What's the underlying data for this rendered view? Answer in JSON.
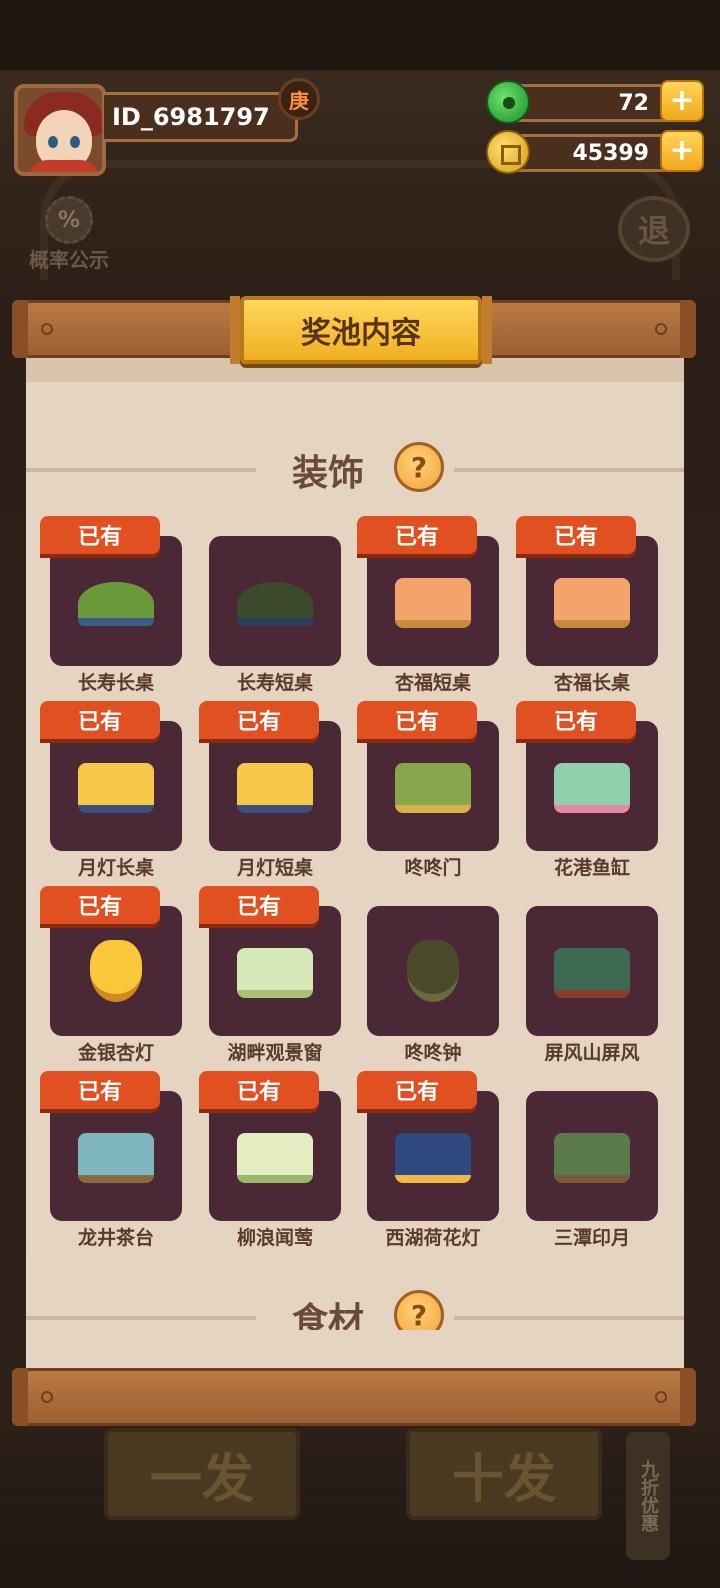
{
  "player": {
    "id": "ID_6981797",
    "badge": "庚"
  },
  "currency": {
    "jade": "72",
    "coins": "45399",
    "plus": "+"
  },
  "side": {
    "probability_icon": "%",
    "probability_label": "概率公示",
    "exit_label": "退"
  },
  "modal": {
    "title": "奖池内容"
  },
  "sections": [
    {
      "label": "装饰",
      "help": "?"
    },
    {
      "label": "食材",
      "help": "?"
    }
  ],
  "owned_label": "已有",
  "items": [
    {
      "name": "长寿长桌",
      "owned": true
    },
    {
      "name": "长寿短桌",
      "owned": false
    },
    {
      "name": "杏福短桌",
      "owned": true
    },
    {
      "name": "杏福长桌",
      "owned": true
    },
    {
      "name": "月灯长桌",
      "owned": true
    },
    {
      "name": "月灯短桌",
      "owned": true
    },
    {
      "name": "咚咚门",
      "owned": true
    },
    {
      "name": "花港鱼缸",
      "owned": true
    },
    {
      "name": "金银杏灯",
      "owned": true
    },
    {
      "name": "湖畔观景窗",
      "owned": true
    },
    {
      "name": "咚咚钟",
      "owned": false
    },
    {
      "name": "屏风山屏风",
      "owned": false
    },
    {
      "name": "龙井茶台",
      "owned": true
    },
    {
      "name": "柳浪闻莺",
      "owned": true
    },
    {
      "name": "西湖荷花灯",
      "owned": true
    },
    {
      "name": "三潭印月",
      "owned": false
    }
  ],
  "background_buttons": {
    "single": "一发",
    "ten": "十发",
    "discount": "九折优惠"
  },
  "colors": {
    "card": "#4a2836",
    "owned_tag": "#e05021",
    "paper": "#e6d4c2",
    "title_plate": "#f5c23a"
  }
}
